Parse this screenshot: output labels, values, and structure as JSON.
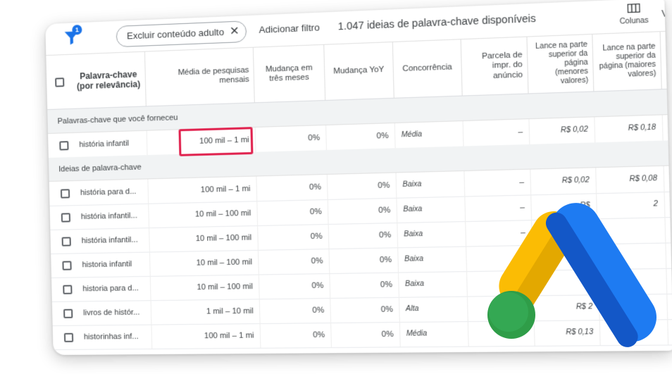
{
  "toolbar": {
    "filter_badge": "1",
    "chip_label": "Excluir conteúdo adulto",
    "chip_close": "✕",
    "add_filter": "Adicionar filtro",
    "ideas_count": "1.047 ideias de palavra-chave disponíveis",
    "columns_label": "Colunas",
    "cut_text": "V"
  },
  "header": {
    "keyword": "Palavra-chave (por relevância)",
    "avg_searches": "Média de pesquisas mensais",
    "three_month": "Mudança em três meses",
    "yoy": "Mudança YoY",
    "competition": "Concorrência",
    "impr_share": "Parcela de impr. do anúncio",
    "bid_low": "Lance na parte superior da página (menores valores)",
    "bid_high": "Lance na parte superior da página (maiores valores)"
  },
  "sections": {
    "provided": "Palavras-chave que você forneceu",
    "ideas": "Ideias de palavra-chave"
  },
  "provided_rows": [
    {
      "keyword": "história infantil",
      "searches": "100 mil – 1 mi",
      "three_month": "0%",
      "yoy": "0%",
      "competition": "Média",
      "impr": "–",
      "bid_low": "R$ 0,02",
      "bid_high": "R$ 0,18"
    }
  ],
  "idea_rows": [
    {
      "keyword": "história para d...",
      "searches": "100 mil – 1 mi",
      "three_month": "0%",
      "yoy": "0%",
      "competition": "Baixa",
      "impr": "–",
      "bid_low": "R$ 0,02",
      "bid_high": "R$ 0,08"
    },
    {
      "keyword": "história infantil...",
      "searches": "10 mil – 100 mil",
      "three_month": "0%",
      "yoy": "0%",
      "competition": "Baixa",
      "impr": "–",
      "bid_low": "R$",
      "bid_high": "2"
    },
    {
      "keyword": "história infantil...",
      "searches": "10 mil – 100 mil",
      "three_month": "0%",
      "yoy": "0%",
      "competition": "Baixa",
      "impr": "–",
      "bid_low": "R",
      "bid_high": ""
    },
    {
      "keyword": "historia infantil",
      "searches": "10 mil – 100 mil",
      "three_month": "0%",
      "yoy": "0%",
      "competition": "Baixa",
      "impr": "–",
      "bid_low": "",
      "bid_high": ""
    },
    {
      "keyword": "historia para d...",
      "searches": "10 mil – 100 mil",
      "three_month": "0%",
      "yoy": "0%",
      "competition": "Baixa",
      "impr": "–",
      "bid_low": "",
      "bid_high": ""
    },
    {
      "keyword": "livros de histór...",
      "searches": "1 mil – 10 mil",
      "three_month": "0%",
      "yoy": "0%",
      "competition": "Alta",
      "impr": "–",
      "bid_low": "R$ 2",
      "bid_high": ""
    },
    {
      "keyword": "historinhas inf...",
      "searches": "100 mil – 1 mi",
      "three_month": "0%",
      "yoy": "0%",
      "competition": "Média",
      "impr": "",
      "bid_low": "R$ 0,13",
      "bid_high": ""
    }
  ],
  "colors": {
    "highlight": "#e0224e",
    "filter_blue": "#1a73e8",
    "logo_blue": "#1e7bf2",
    "logo_yellow": "#fbbc04",
    "logo_green": "#34a853"
  }
}
